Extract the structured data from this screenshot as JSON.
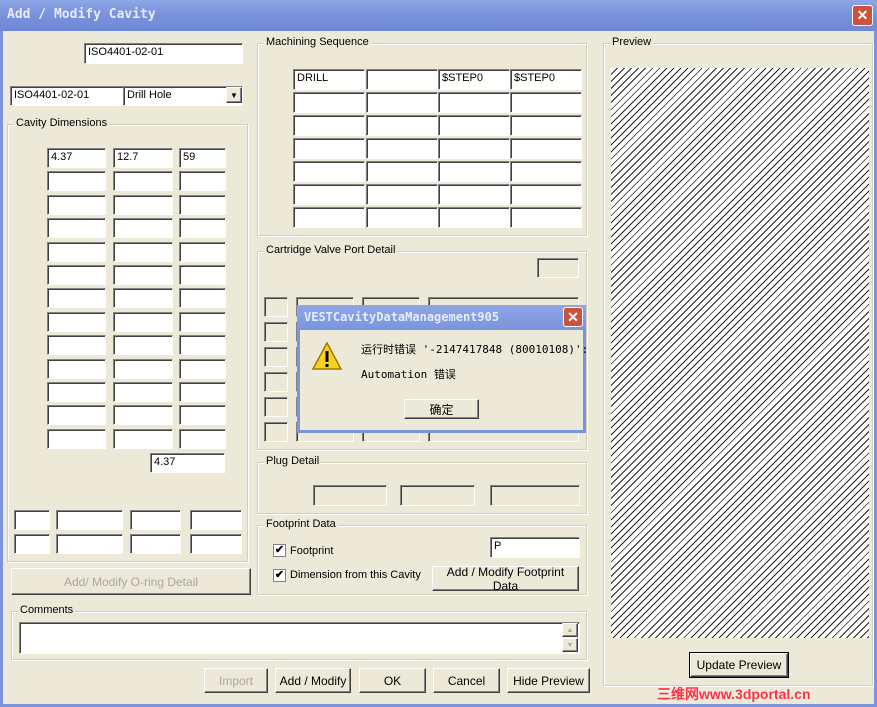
{
  "window": {
    "title": "Add / Modify Cavity",
    "close": "✕"
  },
  "header": {
    "code_top": "ISO4401-02-01",
    "code_left": "ISO4401-02-01",
    "type_select": "Drill Hole"
  },
  "cavity_dimensions": {
    "label": "Cavity Dimensions",
    "rows": [
      [
        "4.37",
        "12.7",
        "59"
      ],
      [
        "",
        "",
        ""
      ],
      [
        "",
        "",
        ""
      ],
      [
        "",
        "",
        ""
      ],
      [
        "",
        "",
        ""
      ],
      [
        "",
        "",
        ""
      ],
      [
        "",
        "",
        ""
      ],
      [
        "",
        "",
        ""
      ],
      [
        "",
        "",
        ""
      ],
      [
        "",
        "",
        ""
      ],
      [
        "",
        "",
        ""
      ],
      [
        "",
        "",
        ""
      ],
      [
        "",
        "",
        ""
      ]
    ],
    "total": "4.37",
    "bottom_rows": [
      [
        "",
        "",
        "",
        ""
      ],
      [
        "",
        "",
        "",
        ""
      ]
    ]
  },
  "oring_button": "Add/ Modify O-ring Detail",
  "machining": {
    "label": "Machining Sequence",
    "rows": [
      [
        "DRILL",
        "",
        "$STEP0",
        "$STEP0"
      ],
      [
        "",
        "",
        "",
        ""
      ],
      [
        "",
        "",
        "",
        ""
      ],
      [
        "",
        "",
        "",
        ""
      ],
      [
        "",
        "",
        "",
        ""
      ],
      [
        "",
        "",
        "",
        ""
      ],
      [
        "",
        "",
        "",
        ""
      ]
    ]
  },
  "cartridge": {
    "label": "Cartridge Valve Port Detail"
  },
  "plug": {
    "label": "Plug Detail"
  },
  "footprint": {
    "label": "Footprint Data",
    "footprint_label": "Footprint",
    "footprint_checked": true,
    "dimension_label": "Dimension from this Cavity",
    "dimension_checked": true,
    "value": "P",
    "button": "Add / Modify Footprint Data"
  },
  "comments": {
    "label": "Comments",
    "value": ""
  },
  "buttons": {
    "import": "Import",
    "add_modify": "Add / Modify",
    "ok": "OK",
    "cancel": "Cancel",
    "hide_preview": "Hide Preview"
  },
  "preview": {
    "label": "Preview",
    "update": "Update Preview"
  },
  "error_dialog": {
    "title": "VESTCavityDataManagement905",
    "message": "运行时错误 '-2147417848 (80010108)':",
    "detail": "Automation 错误",
    "ok": "确定",
    "icon": "warning-icon"
  },
  "watermark": "三维网www.3dportal.cn"
}
